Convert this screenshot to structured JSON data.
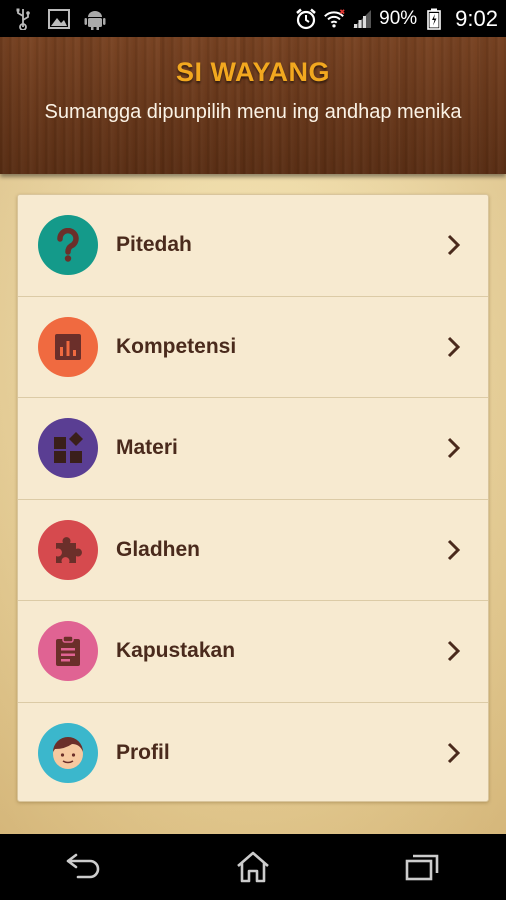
{
  "status_bar": {
    "left_icons": [
      "usb-icon",
      "image-icon",
      "android-icon"
    ],
    "right_icons": [
      "alarm-icon",
      "wifi-icon",
      "signal-icon",
      "battery-icon"
    ],
    "battery_percent": "90%",
    "time": "9:02"
  },
  "header": {
    "title": "SI WAYANG",
    "subtitle": "Sumangga dipunpilih menu ing andhap menika"
  },
  "colors": {
    "title": "#f2a81f",
    "label": "#4a2a1c"
  },
  "menu": {
    "items": [
      {
        "label": "Pitedah",
        "icon": "question-mark-icon",
        "color": "#149a8a"
      },
      {
        "label": "Kompetensi",
        "icon": "bar-chart-icon",
        "color": "#f06a40"
      },
      {
        "label": "Materi",
        "icon": "widgets-icon",
        "color": "#5a3e93"
      },
      {
        "label": "Gladhen",
        "icon": "puzzle-icon",
        "color": "#d64a4e"
      },
      {
        "label": "Kapustakan",
        "icon": "clipboard-icon",
        "color": "#e06393"
      },
      {
        "label": "Profil",
        "icon": "face-icon",
        "color": "#3bb7cc"
      }
    ]
  },
  "nav_bar": {
    "buttons": [
      "back-icon",
      "home-icon",
      "recents-icon"
    ]
  }
}
